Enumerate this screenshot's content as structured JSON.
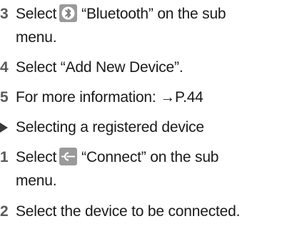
{
  "steps": [
    {
      "number": "3",
      "before": "Select",
      "icon": "bluetooth-icon",
      "label": "“Bluetooth” on the sub",
      "continuation": "menu."
    },
    {
      "number": "4",
      "text": "Select “Add New Device”."
    },
    {
      "number": "5",
      "text": "For more information: →P.44"
    }
  ],
  "section_heading": "Selecting a registered device",
  "steps2": [
    {
      "number": "1",
      "before": "Select",
      "icon": "connect-icon",
      "label": "“Connect” on the sub",
      "continuation": "menu."
    },
    {
      "number": "2",
      "text": "Select the device to be connected."
    }
  ]
}
